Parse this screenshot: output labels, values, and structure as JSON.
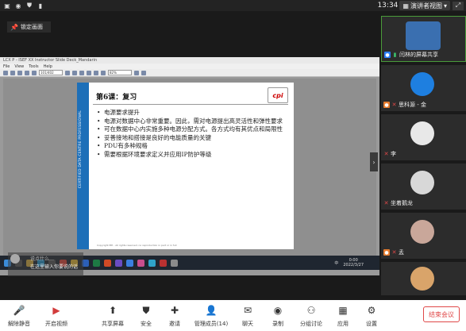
{
  "statusbar": {
    "time": "13:34",
    "view_mode": "演讲者视图",
    "icons": [
      "image-icon",
      "notification-icon",
      "shield-icon",
      "signal-icon"
    ]
  },
  "lock_button": {
    "label": "锁定画面"
  },
  "viewer": {
    "window_title": "LCX P - ISEF XX Instructor Slide Deck_Mandarin",
    "menus": [
      "File",
      "View",
      "Tools",
      "Help"
    ],
    "page_input": "101/402",
    "zoom_input": "82%"
  },
  "slide": {
    "side_text": "CERTIFIED DATA CENTRE PROFESSIONAL",
    "title": "第6课：复习",
    "logo_text": "cpi",
    "bullets": [
      "电源要求提升",
      "电源对数据中心非常重要。因此，需对电源提出高灵活性和弹性要求",
      "可在数据中心内实施多种电源分配方式。各方式均有其优点和局限性",
      "妥善接地和搭接是良好的电能质量的关键",
      "PDU有多种规格",
      "需要根据环境要求定义并应用IP防护等级"
    ],
    "footer": "Copyright EPI - All rights reserved. no reproduction in part or in full"
  },
  "taskbar": {
    "time": "0:00",
    "date": "2022/3/27",
    "lang": "中"
  },
  "chat": {
    "line1": "说点什么…",
    "line2": "在这里输入你要说的话"
  },
  "participants": [
    {
      "name": "闫林的屏幕共享",
      "color": "#3a6fb0",
      "mic": "on",
      "active": true
    },
    {
      "name": "思科源 - 金",
      "color": "#1e7fe0",
      "mic": "off",
      "active": false
    },
    {
      "name": "李",
      "color": "#e8e8e8",
      "mic": "off",
      "active": false
    },
    {
      "name": "坐着鹅龙",
      "color": "#d8d8d8",
      "mic": "off",
      "active": false
    },
    {
      "name": "孟",
      "color": "#c9a79a",
      "mic": "off",
      "active": false
    },
    {
      "name": "",
      "color": "#d9a46a",
      "mic": "off",
      "active": false
    }
  ],
  "bottom_toolbar": {
    "buttons": [
      {
        "label": "解除静音",
        "icon": "mic-muted-icon"
      },
      {
        "label": "开启视频",
        "icon": "video-off-icon"
      },
      {
        "label": "共享屏幕",
        "icon": "share-screen-icon"
      },
      {
        "label": "安全",
        "icon": "shield-icon"
      },
      {
        "label": "邀请",
        "icon": "invite-icon"
      },
      {
        "label": "管理成员(14)",
        "icon": "members-icon"
      },
      {
        "label": "聊天",
        "icon": "chat-icon"
      },
      {
        "label": "录制",
        "icon": "record-icon"
      },
      {
        "label": "分组讨论",
        "icon": "breakout-icon"
      },
      {
        "label": "应用",
        "icon": "apps-icon"
      },
      {
        "label": "设置",
        "icon": "settings-icon"
      }
    ],
    "end_label": "结束会议"
  }
}
